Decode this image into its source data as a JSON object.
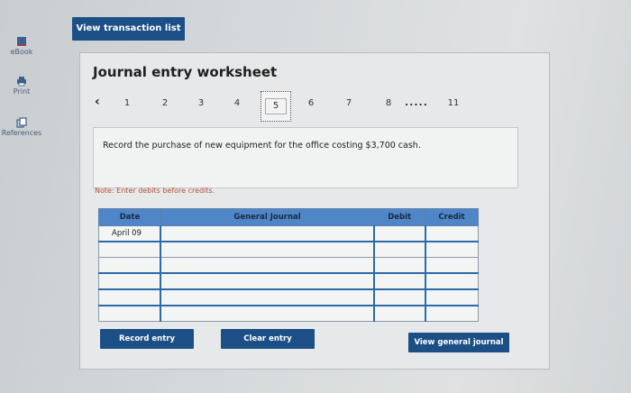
{
  "sidebar": {
    "items": [
      {
        "label": "eBook"
      },
      {
        "label": "Print"
      },
      {
        "label": "References"
      }
    ]
  },
  "header": {
    "view_transaction_label": "View transaction list"
  },
  "worksheet": {
    "title": "Journal entry worksheet",
    "pager": {
      "prev_icon": "chevron-left-icon",
      "next_icon": "chevron-right-icon",
      "pages": [
        "1",
        "2",
        "3",
        "4",
        "5",
        "6",
        "7",
        "8"
      ],
      "active_page": "5",
      "ellipsis": ".....",
      "last_page": "11"
    },
    "instruction": "Record the purchase of new equipment for the office costing $3,700 cash.",
    "note": "Note: Enter debits before credits.",
    "table": {
      "headers": {
        "date": "Date",
        "general_journal": "General Journal",
        "debit": "Debit",
        "credit": "Credit"
      },
      "rows": [
        {
          "date": "April 09",
          "account": "",
          "debit": "",
          "credit": ""
        },
        {
          "date": "",
          "account": "",
          "debit": "",
          "credit": ""
        },
        {
          "date": "",
          "account": "",
          "debit": "",
          "credit": ""
        },
        {
          "date": "",
          "account": "",
          "debit": "",
          "credit": ""
        },
        {
          "date": "",
          "account": "",
          "debit": "",
          "credit": ""
        },
        {
          "date": "",
          "account": "",
          "debit": "",
          "credit": ""
        }
      ]
    },
    "buttons": {
      "record_entry": "Record entry",
      "clear_entry": "Clear entry",
      "view_general_journal": "View general journal"
    }
  },
  "colors": {
    "button_blue": "#1b4f86",
    "header_blue": "#4f86c8",
    "note_red": "#b3513a"
  }
}
